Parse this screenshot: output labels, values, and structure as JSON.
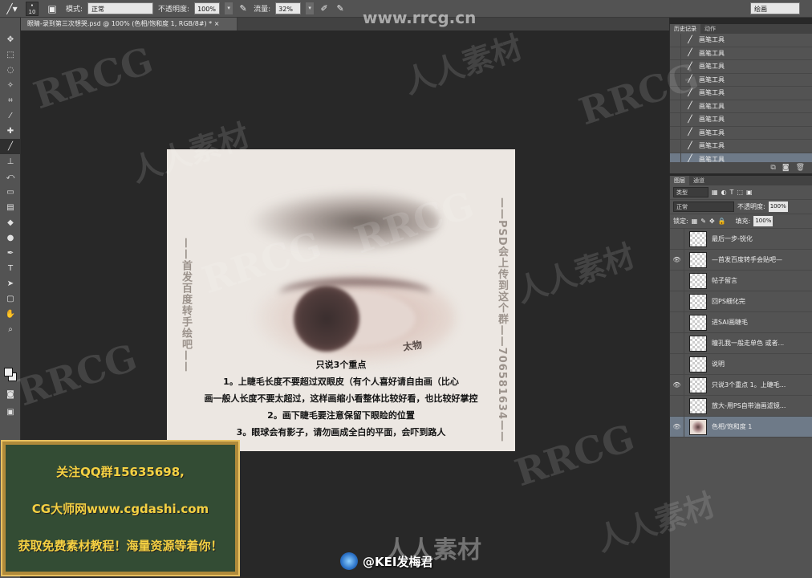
{
  "options_bar": {
    "brush_size": "10",
    "mode_label": "模式:",
    "mode_value": "正常",
    "opacity_label": "不透明度:",
    "opacity_value": "100%",
    "flow_label": "流量:",
    "flow_value": "32%",
    "workspace": "绘画"
  },
  "document_tab": "眼睛-录到第三次想哭.psd @ 100% (色相/饱和度 1, RGB/8#) *",
  "canvas": {
    "left_vertical": "——首发百度转手绘吧——",
    "right_vertical": "——PSD会上传到这个群——706581634——",
    "scribble": "太物",
    "notes": [
      "只说3个重点",
      "1。上睫毛长度不要超过双眼皮（有个人喜好请自由画（比心",
      "画一般人长度不要太超过，这样画缩小看整体比较好看，也比较好掌控",
      "2。画下睫毛要注意保留下眼睑的位置",
      "3。眼球会有影子，请勿画成全白的平面，会吓到路人"
    ]
  },
  "history_panel": {
    "tabs": [
      "历史记录",
      "动作"
    ],
    "items": [
      "画笔工具",
      "画笔工具",
      "画笔工具",
      "画笔工具",
      "画笔工具",
      "画笔工具",
      "画笔工具",
      "画笔工具",
      "画笔工具",
      "画笔工具"
    ]
  },
  "layers_panel": {
    "tabs": [
      "图层",
      "通道"
    ],
    "filter_label": "类型",
    "blend_mode": "正常",
    "opacity_label": "不透明度:",
    "opacity_value": "100%",
    "lock_label": "锁定:",
    "fill_label": "填充:",
    "fill_value": "100%",
    "layers": [
      {
        "name": "最后一步-锐化",
        "visible": false
      },
      {
        "name": "—首发百度转手会贴吧—",
        "visible": true
      },
      {
        "name": "帖子留言",
        "visible": false
      },
      {
        "name": "回PS细化完",
        "visible": false
      },
      {
        "name": "进SAI画睫毛",
        "visible": false
      },
      {
        "name": "瞳孔我一般走单色 或者...",
        "visible": false
      },
      {
        "name": "说明",
        "visible": false
      },
      {
        "name": "只说3个重点 1。上睫毛...",
        "visible": true
      },
      {
        "name": "放大-用PS自带油画滤镜...",
        "visible": false
      },
      {
        "name": "色相/饱和度 1",
        "visible": true
      }
    ]
  },
  "promo": {
    "line1": "关注QQ群15635698,",
    "line2": "CG大师网www.cgdashi.com",
    "line3": "获取免费素材教程！海量资源等着你！"
  },
  "credit": "@KEI发梅君",
  "watermark": {
    "url": "www.rrcg.cn",
    "brand": "RRCG",
    "cn": "人人素材"
  }
}
